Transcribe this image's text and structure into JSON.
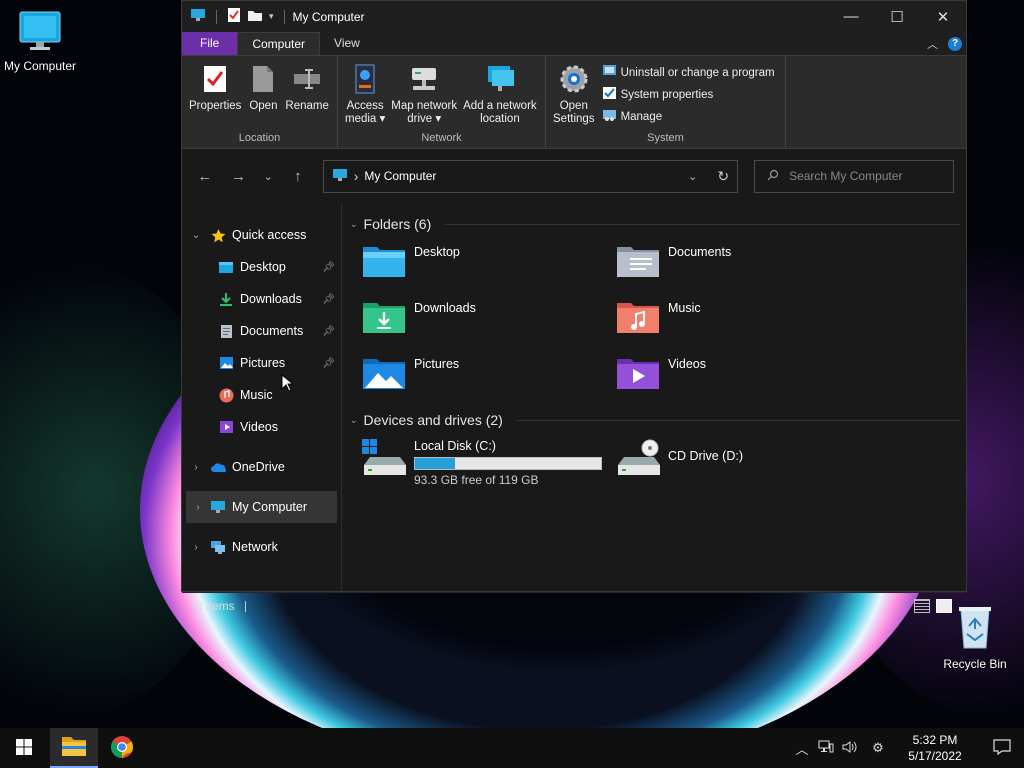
{
  "desktop": {
    "icons": [
      {
        "label": "My Computer"
      },
      {
        "label": "Recycle Bin"
      }
    ]
  },
  "window": {
    "title": "My Computer",
    "controls": {
      "minimize": "—",
      "maximize": "☐",
      "close": "✕"
    },
    "ribbon_tabs": [
      {
        "label": "File"
      },
      {
        "label": "Computer"
      },
      {
        "label": "View"
      }
    ],
    "ribbon": {
      "location": {
        "label": "Location",
        "buttons": [
          {
            "label": "Properties"
          },
          {
            "label": "Open"
          },
          {
            "label": "Rename"
          }
        ]
      },
      "network": {
        "label": "Network",
        "buttons": [
          {
            "line1": "Access",
            "line2": "media ▾"
          },
          {
            "line1": "Map network",
            "line2": "drive ▾"
          },
          {
            "line1": "Add a network",
            "line2": "location"
          }
        ]
      },
      "system": {
        "label": "System",
        "open_settings": {
          "line1": "Open",
          "line2": "Settings"
        },
        "items": [
          {
            "label": "Uninstall or change a program"
          },
          {
            "label": "System properties"
          },
          {
            "label": "Manage"
          }
        ]
      }
    },
    "address": {
      "path": "My Computer",
      "separator": "›",
      "search_placeholder": "Search My Computer"
    },
    "nav_pane": {
      "quick_access": "Quick access",
      "quick_items": [
        {
          "label": "Desktop",
          "pinned": true
        },
        {
          "label": "Downloads",
          "pinned": true
        },
        {
          "label": "Documents",
          "pinned": true
        },
        {
          "label": "Pictures",
          "pinned": true
        },
        {
          "label": "Music",
          "pinned": false
        },
        {
          "label": "Videos",
          "pinned": false
        }
      ],
      "roots": [
        {
          "label": "OneDrive"
        },
        {
          "label": "My Computer",
          "selected": true
        },
        {
          "label": "Network"
        }
      ]
    },
    "content": {
      "folders_header": "Folders (6)",
      "folders": [
        {
          "label": "Desktop"
        },
        {
          "label": "Documents"
        },
        {
          "label": "Downloads"
        },
        {
          "label": "Music"
        },
        {
          "label": "Pictures"
        },
        {
          "label": "Videos"
        }
      ],
      "drives_header": "Devices and drives (2)",
      "drives": [
        {
          "label": "Local Disk (C:)",
          "free_text": "93.3 GB free of 119 GB",
          "used_fraction": 0.216
        },
        {
          "label": "CD Drive (D:)"
        }
      ]
    },
    "status": {
      "items": "8 items"
    }
  },
  "taskbar": {
    "time": "5:32 PM",
    "date": "5/17/2022"
  },
  "colors": {
    "file_tab": "#6b2fa8",
    "accent_blue": "#26a0da",
    "window_bg": "#191919"
  }
}
